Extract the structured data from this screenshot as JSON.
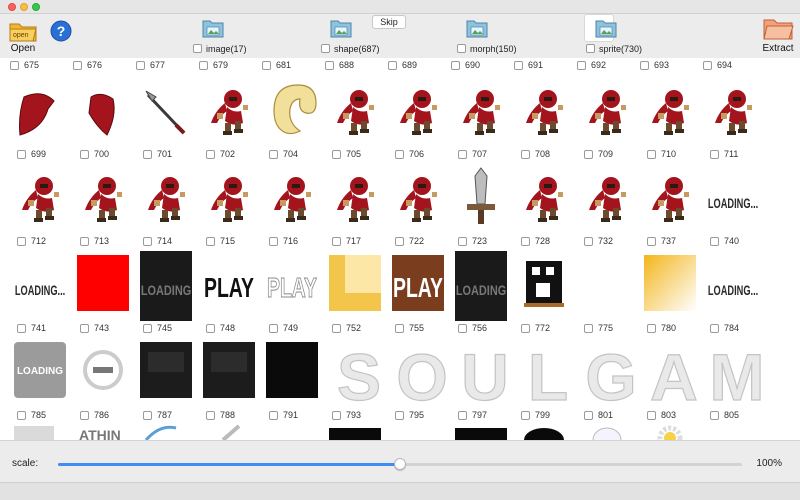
{
  "toolbar": {
    "open_label": "Open",
    "open_icon_text": "open",
    "extract_label": "Extract",
    "skip_label": "Skip",
    "tabs": [
      {
        "label": "image(17)",
        "icon": "folder-image-icon",
        "active": false
      },
      {
        "label": "shape(687)",
        "icon": "folder-shape-icon",
        "active": false
      },
      {
        "label": "morph(150)",
        "icon": "folder-morph-icon",
        "active": false
      },
      {
        "label": "sprite(730)",
        "icon": "folder-sprite-icon",
        "active": true
      }
    ]
  },
  "top_row_labels": [
    "675",
    "676",
    "677",
    "679",
    "681",
    "688",
    "689",
    "690",
    "691",
    "692",
    "693",
    "694"
  ],
  "rows": [
    {
      "labels": [
        "699",
        "700",
        "701",
        "702",
        "704",
        "705",
        "706",
        "707",
        "708",
        "709",
        "710",
        "711"
      ]
    },
    {
      "labels": [
        "712",
        "713",
        "714",
        "715",
        "716",
        "717",
        "722",
        "723",
        "728",
        "732",
        "737",
        "740"
      ]
    },
    {
      "labels": [
        "741",
        "743",
        "745",
        "748",
        "749",
        "752",
        "755",
        "756",
        "772",
        "775",
        "780",
        "784"
      ]
    },
    {
      "labels": [
        "785",
        "786",
        "787",
        "788",
        "791",
        "793",
        "795",
        "797",
        "799",
        "801",
        "803",
        "805"
      ]
    }
  ],
  "thumb_texts": {
    "loading": "LOADING...",
    "loading_small": "LOADING",
    "play": "PLAY",
    "soulgame": [
      "S",
      "O",
      "U",
      "L",
      "G",
      "A",
      "M"
    ]
  },
  "scale": {
    "label": "scale:",
    "value_text": "100%",
    "fraction": 0.5
  },
  "colors": {
    "accent": "#3d8df5",
    "ninja_red": "#a3141c",
    "red_square": "#ff0000"
  }
}
